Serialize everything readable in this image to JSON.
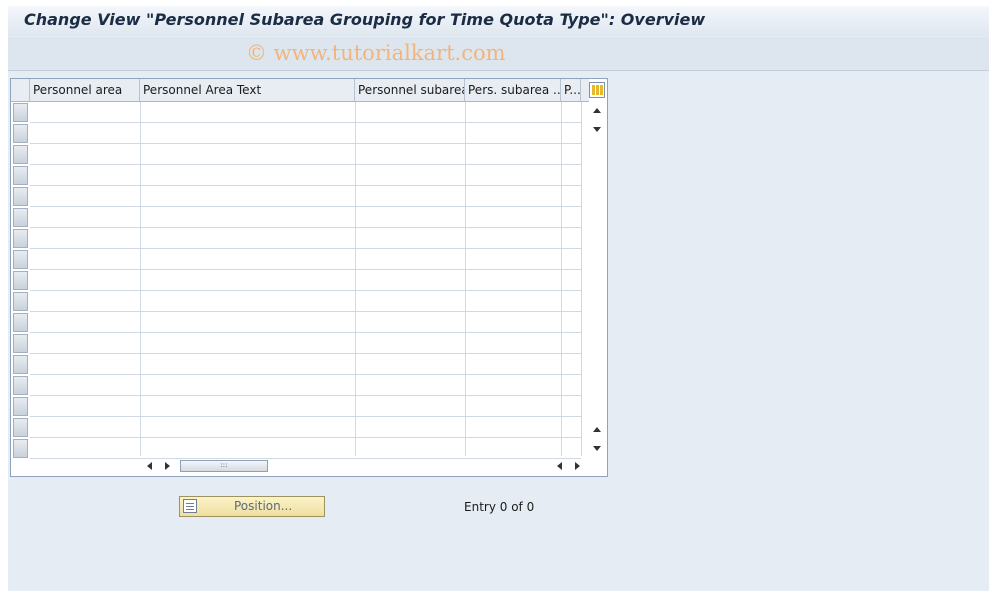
{
  "window": {
    "title": "Change View \"Personnel Subarea Grouping for Time Quota Type\": Overview"
  },
  "watermark": "© www.tutorialkart.com",
  "table": {
    "columns": [
      "Personnel area",
      "Personnel Area Text",
      "Personnel subarea",
      "Pers. subarea ...",
      "P..."
    ],
    "rows": []
  },
  "footer": {
    "position_label": "Position...",
    "entry_text": "Entry 0 of 0"
  },
  "colors": {
    "background": "#e5ecf4",
    "title_text": "#1b2c45",
    "watermark": "#f4b070",
    "button_fill": "#efe0a0"
  },
  "icons": {
    "column_config": "table-settings-icon",
    "position": "position-icon"
  }
}
